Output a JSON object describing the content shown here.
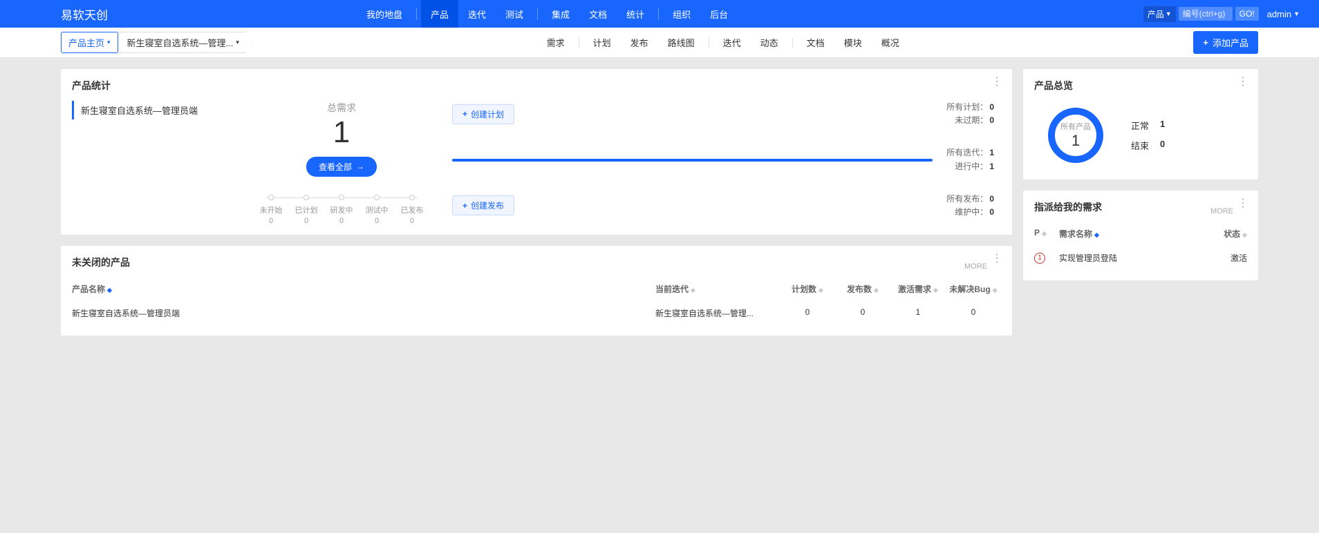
{
  "brand": "易软天创",
  "topnav": {
    "items": [
      "我的地盘",
      "产品",
      "迭代",
      "测试",
      "集成",
      "文档",
      "统计",
      "组织",
      "后台"
    ],
    "active": "产品",
    "groups": [
      [
        "我的地盘"
      ],
      [
        "产品",
        "迭代",
        "测试"
      ],
      [
        "集成",
        "文档",
        "统计"
      ],
      [
        "组织",
        "后台"
      ]
    ]
  },
  "search": {
    "type": "产品",
    "placeholder": "编号(ctrl+g)",
    "go": "GO!"
  },
  "user": "admin",
  "crumb": {
    "home": "产品主页",
    "product": "新生寝室自选系统—管理..."
  },
  "subnav": {
    "groups": [
      [
        "需求"
      ],
      [
        "计划",
        "发布",
        "路线图"
      ],
      [
        "迭代",
        "动态"
      ],
      [
        "文档",
        "模块",
        "概况"
      ]
    ]
  },
  "add_product": "添加产品",
  "stats_card": {
    "title": "产品统计",
    "selected": "新生寝室自选系统—管理员端",
    "big_label": "总需求",
    "big_value": "1",
    "view_all": "查看全部",
    "flow": [
      {
        "label": "未开始",
        "count": "0"
      },
      {
        "label": "已计划",
        "count": "0"
      },
      {
        "label": "研发中",
        "count": "0"
      },
      {
        "label": "测试中",
        "count": "0"
      },
      {
        "label": "已发布",
        "count": "0"
      }
    ],
    "rows": [
      {
        "btn": "创建计划",
        "kv": [
          {
            "k": "所有计划：",
            "v": "0"
          },
          {
            "k": "未过期：",
            "v": "0"
          }
        ]
      },
      {
        "progress": true,
        "kv": [
          {
            "k": "所有迭代：",
            "v": "1"
          },
          {
            "k": "进行中：",
            "v": "1"
          }
        ]
      },
      {
        "btn": "创建发布",
        "kv": [
          {
            "k": "所有发布：",
            "v": "0"
          },
          {
            "k": "维护中：",
            "v": "0"
          }
        ]
      }
    ]
  },
  "unclosed": {
    "title": "未关闭的产品",
    "more": "MORE",
    "cols": [
      "产品名称",
      "当前迭代",
      "计划数",
      "发布数",
      "激活需求",
      "未解决Bug"
    ],
    "row": {
      "name": "新生寝室自选系统—管理员端",
      "iter": "新生寝室自选系统—管理...",
      "plans": "0",
      "rel": "0",
      "active": "1",
      "bugs": "0"
    }
  },
  "overview": {
    "title": "产品总览",
    "ring_label": "所有产品",
    "ring_value": "1",
    "stats": [
      {
        "k": "正常",
        "v": "1"
      },
      {
        "k": "结束",
        "v": "0"
      }
    ]
  },
  "assigned": {
    "title": "指派给我的需求",
    "more": "MORE",
    "cols": {
      "p": "P",
      "name": "需求名称",
      "status": "状态"
    },
    "row": {
      "p": "1",
      "name": "实现管理员登陆",
      "status": "激活"
    }
  }
}
